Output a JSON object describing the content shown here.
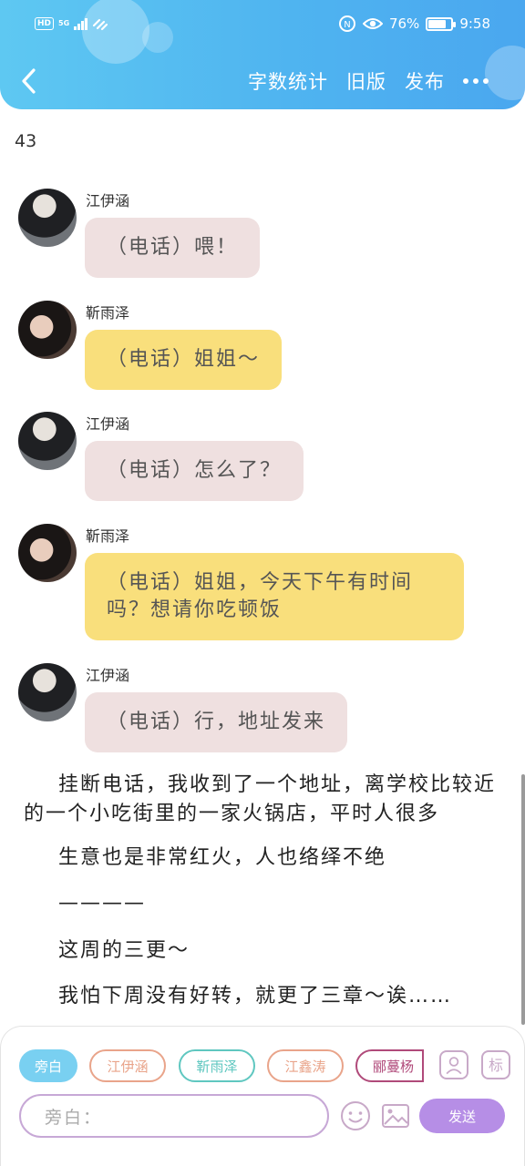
{
  "status_bar": {
    "hd": "HD",
    "network": "5G",
    "battery_text": "76%",
    "battery_level": 0.76,
    "time": "9:58"
  },
  "header": {
    "back_icon": "chevron-left-icon",
    "actions": [
      "字数统计",
      "旧版",
      "发布"
    ],
    "more_icon": "more-horizontal-icon",
    "color_start": "#5ec8f2",
    "color_end": "#4aa7ef"
  },
  "chapter_number": "43",
  "messages": [
    {
      "speaker": "江伊涵",
      "text": "（电话）喂！",
      "bubble_color": "#efe0e0"
    },
    {
      "speaker": "靳雨泽",
      "text": "（电话）姐姐～",
      "bubble_color": "#f9df7c"
    },
    {
      "speaker": "江伊涵",
      "text": "（电话）怎么了？",
      "bubble_color": "#efe0e0"
    },
    {
      "speaker": "靳雨泽",
      "text": "（电话）姐姐，今天下午有时间吗？想请你吃顿饭",
      "bubble_color": "#f9df7c"
    },
    {
      "speaker": "江伊涵",
      "text": "（电话）行，地址发来",
      "bubble_color": "#efe0e0"
    }
  ],
  "narration": [
    "挂断电话，我收到了一个地址，离学校比较近的一个小吃街里的一家火锅店，平时人很多",
    "生意也是非常红火，人也络绎不绝",
    "————",
    "这周的三更～",
    "我怕下周没有好转，就更了三章～诶……"
  ],
  "composer": {
    "roles": [
      {
        "label": "旁白",
        "color": "#79d0f1"
      },
      {
        "label": "江伊涵",
        "color": "#e9a48a"
      },
      {
        "label": "靳雨泽",
        "color": "#5fc7c0"
      },
      {
        "label": "江鑫涛",
        "color": "#e9a48a"
      },
      {
        "label": "郦蔓杨",
        "color": "#b04a7a"
      }
    ],
    "input_placeholder": "旁白：",
    "send_label": "发送",
    "tool_icons": [
      "role-manager-icon",
      "tag-icon",
      "emoji-icon",
      "image-icon"
    ]
  }
}
